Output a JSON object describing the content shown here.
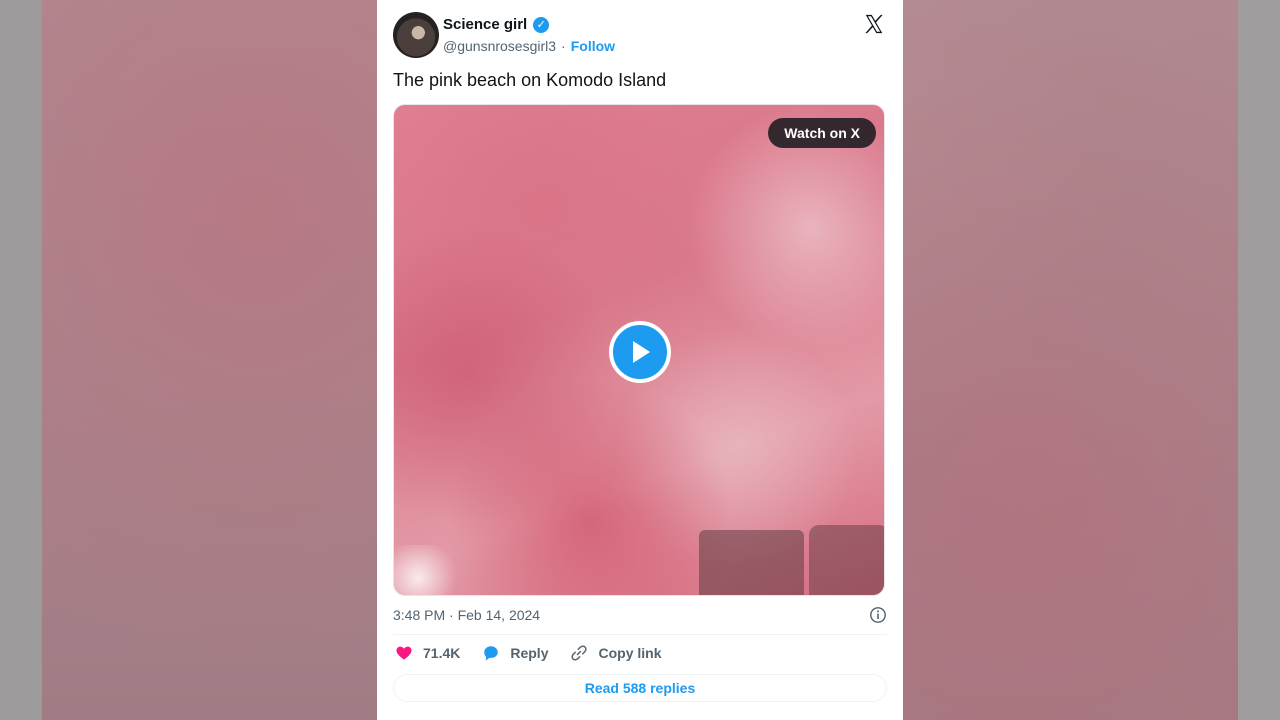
{
  "author": {
    "name": "Science girl",
    "handle": "@gunsnrosesgirl3",
    "separator": "·",
    "follow_label": "Follow"
  },
  "tweet": {
    "text": "The pink beach on Komodo Island",
    "timestamp": "3:48 PM · Feb 14, 2024"
  },
  "media": {
    "watch_label": "Watch on X"
  },
  "actions": {
    "likes": "71.4K",
    "reply_label": "Reply",
    "copy_link_label": "Copy link"
  },
  "replies_button": "Read 588 replies",
  "colors": {
    "accent": "#1d9bf0",
    "like": "#f91880",
    "text": "#0f1419",
    "muted": "#536471"
  },
  "icons": [
    "verified-badge-icon",
    "x-logo-icon",
    "play-icon",
    "info-icon",
    "heart-icon",
    "reply-bubble-icon",
    "link-icon"
  ]
}
